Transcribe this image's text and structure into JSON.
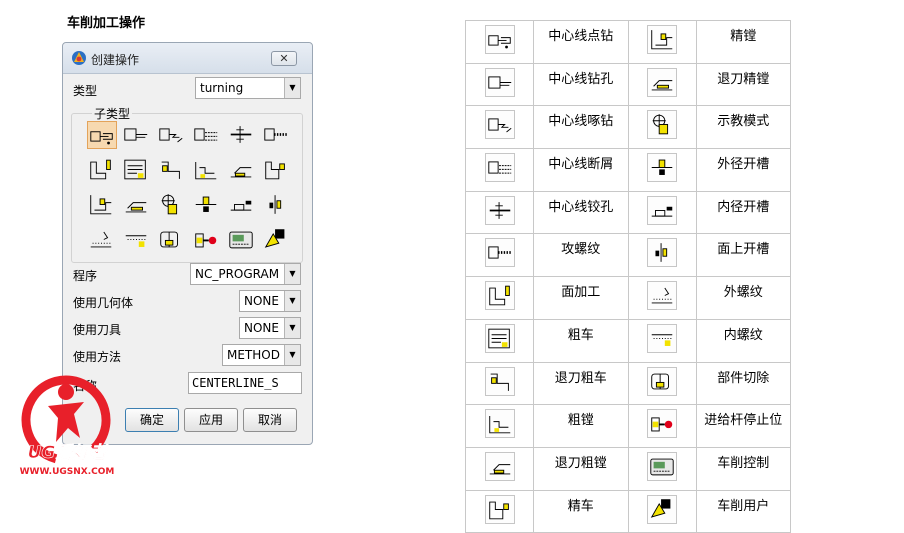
{
  "heading": "车削加工操作",
  "dialog": {
    "title": "创建操作",
    "close_label": "✕",
    "type_label": "类型",
    "type_value": "turning",
    "subtype_label": "子类型",
    "subtype_icons": [
      "centerline-spotdrill-icon",
      "centerline-drilling-icon",
      "centerline-peckdrill-icon",
      "centerline-breakchip-icon",
      "centerline-reaming-icon",
      "centerline-tapping-icon",
      "facing-icon",
      "rough-turn-od-icon",
      "rough-back-turn-icon",
      "rough-bore-id-icon",
      "rough-back-bore-icon",
      "finish-turn-od-icon",
      "finish-bore-id-icon",
      "finish-back-bore-icon",
      "teach-mode-icon",
      "groove-od-icon",
      "groove-id-icon",
      "groove-face-icon",
      "thread-od-icon",
      "thread-id-icon",
      "partoff-icon",
      "bar-stop-icon",
      "lathe-control-icon",
      "lathe-user-icon"
    ],
    "program_label": "程序",
    "program_value": "NC_PROGRAM",
    "geometry_label": "使用几何体",
    "geometry_value": "NONE",
    "tool_label": "使用刀具",
    "tool_value": "NONE",
    "method_label": "使用方法",
    "method_value": "METHOD",
    "name_label": "名称",
    "name_value": "CENTERLINE_S",
    "ok_label": "确定",
    "apply_label": "应用",
    "cancel_label": "取消"
  },
  "watermark": {
    "brand": "UG爱好者",
    "url": "WWW.UGSNX.COM"
  },
  "operations": [
    {
      "left_label": "中心线点钻",
      "right_label": "精镗"
    },
    {
      "left_label": "中心线钻孔",
      "right_label": "退刀精镗"
    },
    {
      "left_label": "中心线啄钻",
      "right_label": "示教模式"
    },
    {
      "left_label": "中心线断屑",
      "right_label": "外径开槽"
    },
    {
      "left_label": "中心线铰孔",
      "right_label": "内径开槽"
    },
    {
      "left_label": "攻螺纹",
      "right_label": "面上开槽"
    },
    {
      "left_label": "面加工",
      "right_label": "外螺纹"
    },
    {
      "left_label": "粗车",
      "right_label": "内螺纹"
    },
    {
      "left_label": "退刀粗车",
      "right_label": "部件切除"
    },
    {
      "left_label": "粗镗",
      "right_label": "进给杆停止位"
    },
    {
      "left_label": "退刀粗镗",
      "right_label": "车削控制"
    },
    {
      "left_label": "精车",
      "right_label": "车削用户"
    }
  ],
  "colors": {
    "accent_yellow": "#f2e200",
    "accent_red": "#e0001a",
    "selected_bg": "#f7d9b0",
    "watermark_red": "#e8202a"
  }
}
